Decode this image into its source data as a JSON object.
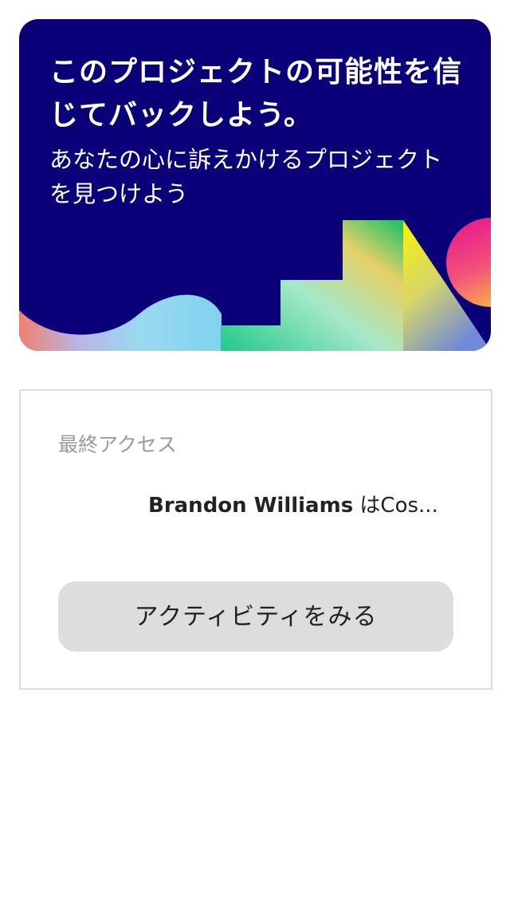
{
  "hero": {
    "title": "このプロジェクトの可能性を信じてバックしよう。",
    "subtitle": "あなたの心に訴えかけるプロジェクトを見つけよう",
    "background_color": "#0a0078"
  },
  "activity": {
    "label": "最終アクセス",
    "user_name": "Brandon Williams",
    "text": " はCos...",
    "button_label": "アクティビティをみる"
  }
}
